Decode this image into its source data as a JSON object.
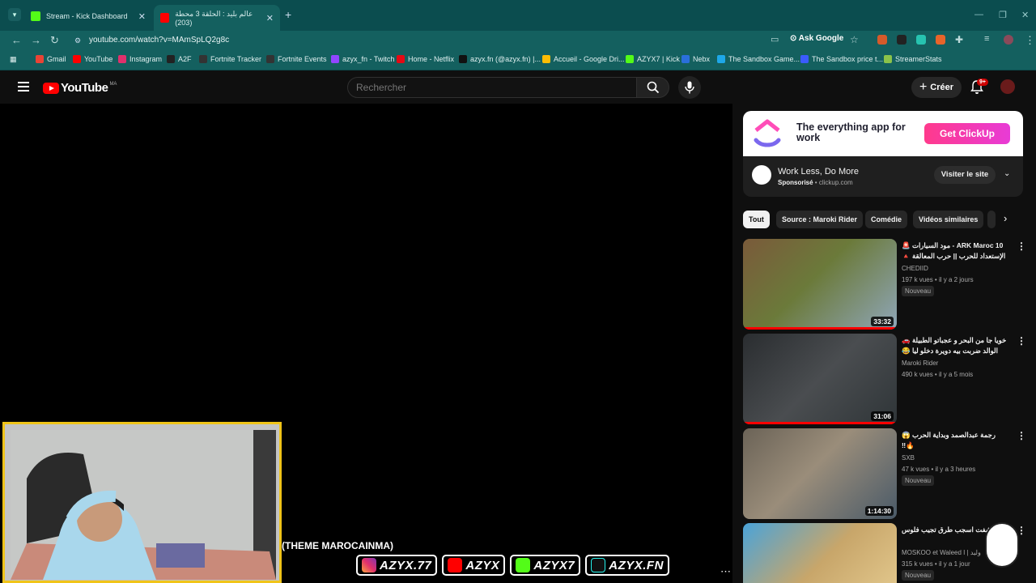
{
  "browser": {
    "tabs": [
      {
        "title": "Stream - Kick Dashboard",
        "favicon_color": "#53fc18"
      },
      {
        "title": "عالم بليد : الحلقة 3 محطة (203)",
        "favicon_color": "#ff0000"
      }
    ],
    "url": "youtube.com/watch?v=MAmSpLQ2g8c",
    "ask_google": "Ask Google",
    "bookmarks": [
      {
        "label": "Gmail",
        "color": "#ea4335"
      },
      {
        "label": "YouTube",
        "color": "#ff0000"
      },
      {
        "label": "Instagram",
        "color": "#e1306c"
      },
      {
        "label": "A2F",
        "color": "#222222"
      },
      {
        "label": "Fortnite Tracker",
        "color": "#333333"
      },
      {
        "label": "Fortnite Events",
        "color": "#333333"
      },
      {
        "label": "azyx_fn - Twitch",
        "color": "#9146ff"
      },
      {
        "label": "Home - Netflix",
        "color": "#e50914"
      },
      {
        "label": "azyx.fn (@azyx.fn) |...",
        "color": "#111111"
      },
      {
        "label": "Accueil - Google Dri...",
        "color": "#fbbc04"
      },
      {
        "label": "AZYX7 | Kick",
        "color": "#53fc18"
      },
      {
        "label": "Nebx",
        "color": "#2a6fdb"
      },
      {
        "label": "The Sandbox Game...",
        "color": "#1ea7e8"
      },
      {
        "label": "The Sandbox price t...",
        "color": "#3b5bfd"
      },
      {
        "label": "StreamerStats",
        "color": "#8bc34a"
      }
    ]
  },
  "youtube": {
    "logo_text": "YouTube",
    "country_code": "MA",
    "search_placeholder": "Rechercher",
    "create_label": "Créer",
    "notifications_badge": "9+"
  },
  "ad": {
    "headline": "The everything app for work",
    "cta": "Get ClickUp",
    "title": "Work Less, Do More",
    "sponsored": "Sponsorisé",
    "domain": "clickup.com",
    "visit": "Visiter le site"
  },
  "chips": [
    "Tout",
    "Source : Maroki Rider",
    "Comédie",
    "Vidéos similaires"
  ],
  "recommendations": [
    {
      "title": "ARK Maroc 10 - مود السيارات 🚨 الإستعداد للحرب || حرب المعالقة 🔺 ...",
      "channel": "CHEDIID",
      "views": "197 k vues • il y a 2 jours",
      "badge": "Nouveau",
      "duration": "33:32",
      "progress": 1.0,
      "thumb": "#6b7a3a"
    },
    {
      "title": "خويا جا من البحر و عجباتو الطبيلة 🚗 الوالد ضربت بيه دويرة دخلو ليا 😂",
      "channel": "Maroki Rider",
      "views": "490 k vues • il y a 5 mois",
      "badge": "",
      "duration": "31:06",
      "progress": 1.0,
      "thumb": "#3a3d40"
    },
    {
      "title": "رجمة عبدالصمد وبداية الحرب 😱🔥‼",
      "channel": "SXB",
      "views": "47 k vues • il y a 3 heures",
      "badge": "Nouveau",
      "duration": "1:14:30",
      "progress": 0,
      "thumb": "#9a8d7a"
    },
    {
      "title": "!! اكتشفت اسجب طرق تجيب فلوس",
      "channel": "MOSKOO et Waleed I | وليد",
      "views": "315 k vues • il y a 1 jour",
      "badge": "Nouveau",
      "duration": "",
      "progress": 0,
      "thumb": "#c8a66a"
    }
  ],
  "overlay": {
    "theme_text": "(THEME MAROCAINMA)",
    "socials": [
      {
        "handle": "AZYX.77",
        "color": "#e1306c"
      },
      {
        "handle": "AZYX",
        "color": "#ff0000"
      },
      {
        "handle": "AZYX7",
        "color": "#53fc18"
      },
      {
        "handle": "AZYX.FN",
        "color": "#111111"
      }
    ]
  }
}
